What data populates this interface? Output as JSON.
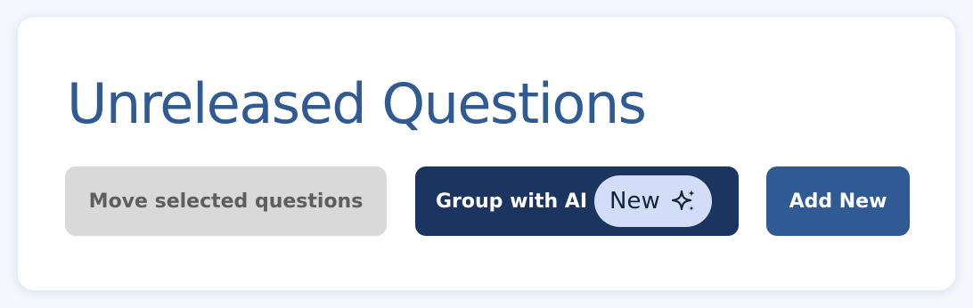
{
  "header": {
    "title": "Unreleased Questions"
  },
  "actions": {
    "move_label": "Move selected questions",
    "group_ai_label": "Group with AI",
    "group_ai_badge": "New",
    "group_ai_badge_icon": "sparkle-icon",
    "add_new_label": "Add New"
  },
  "colors": {
    "title": "#2f5a94",
    "move_button_bg": "#d9d9d9",
    "group_ai_button_bg": "#1b3560",
    "badge_bg": "#d3ddf7",
    "add_button_bg": "#2f5a94"
  }
}
